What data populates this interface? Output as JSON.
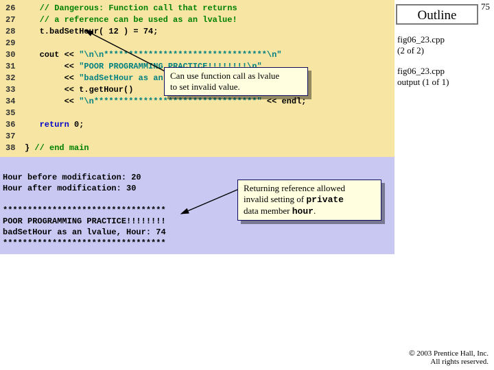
{
  "slide_number": "75",
  "outline_label": "Outline",
  "meta": {
    "file1_line1": "fig06_23.cpp",
    "file1_line2": "(2 of 2)",
    "file2_line1": "fig06_23.cpp",
    "file2_line2": "output (1 of 1)"
  },
  "code": {
    "l26": {
      "n": "26",
      "a": "   ",
      "b": "// Dangerous: Function call that returns"
    },
    "l27": {
      "n": "27",
      "a": "   ",
      "b": "// a reference can be used as an lvalue!"
    },
    "l28": {
      "n": "28",
      "a": "   t.badSetHour( ",
      "num": "12",
      "b": " ) = ",
      "num2": "74",
      "c": ";"
    },
    "l29": {
      "n": "29",
      "a": ""
    },
    "l30": {
      "n": "30",
      "a": "   cout << ",
      "s": "\"\\n\\n*********************************\\n\""
    },
    "l31": {
      "n": "31",
      "a": "        << ",
      "s": "\"POOR PROGRAMMING PRACTICE!!!!!!!!\\n\""
    },
    "l32": {
      "n": "32",
      "a": "        << ",
      "s": "\"badSetHour as an lvalue, Hour: \""
    },
    "l33": {
      "n": "33",
      "a": "        << t.getHour()"
    },
    "l34": {
      "n": "34",
      "a": "        << ",
      "s": "\"\\n*********************************\"",
      "b": " << endl;"
    },
    "l35": {
      "n": "35",
      "a": ""
    },
    "l36": {
      "n": "36",
      "a": "   ",
      "kw": "return",
      "b": " ",
      "num": "0",
      "c": ";"
    },
    "l37": {
      "n": "37",
      "a": ""
    },
    "l38": {
      "n": "38",
      "a": "} ",
      "b": "// end main"
    }
  },
  "output": {
    "l1": "Hour before modification: 20",
    "l2": "Hour after modification: 30",
    "l3": "",
    "l4": "*********************************",
    "l5": "POOR PROGRAMMING PRACTICE!!!!!!!!",
    "l6": "badSetHour as an lvalue, Hour: 74",
    "l7": "*********************************"
  },
  "callout1": {
    "line1": "Can use function call as lvalue",
    "line2": "to set invalid value."
  },
  "callout2": {
    "line1": "Returning reference allowed",
    "line2": "invalid setting of ",
    "mono1": "private",
    "line3": "data member ",
    "mono2": "hour",
    "line4": "."
  },
  "copyright": {
    "sym": "©",
    "line1": " 2003 Prentice Hall, Inc.",
    "line2": "All rights reserved."
  }
}
